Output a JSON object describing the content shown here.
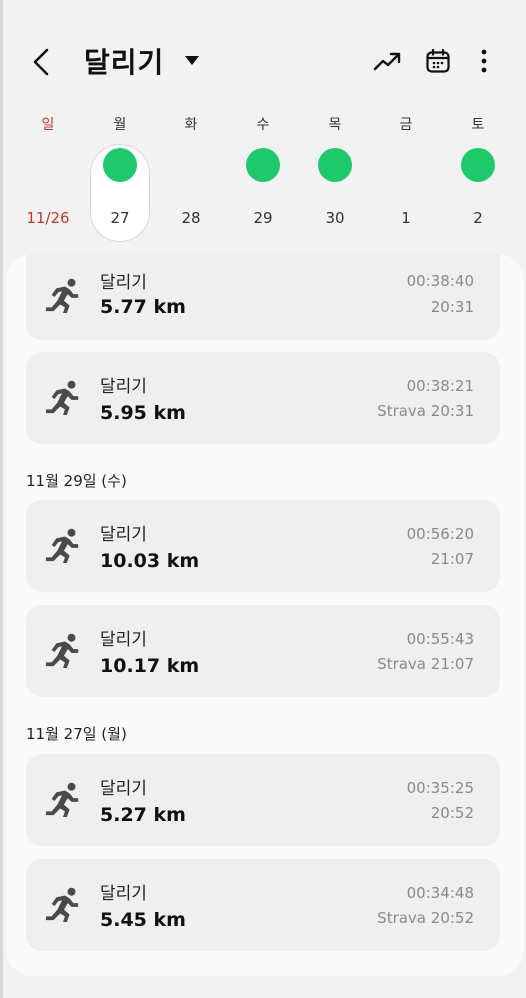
{
  "header": {
    "title": "달리기"
  },
  "week": {
    "days": [
      {
        "dow": "일",
        "date": "11/26",
        "has_record": false
      },
      {
        "dow": "월",
        "date": "27",
        "has_record": true
      },
      {
        "dow": "화",
        "date": "28",
        "has_record": false
      },
      {
        "dow": "수",
        "date": "29",
        "has_record": true
      },
      {
        "dow": "목",
        "date": "30",
        "has_record": true
      },
      {
        "dow": "금",
        "date": "1",
        "has_record": false
      },
      {
        "dow": "토",
        "date": "2",
        "has_record": true
      }
    ],
    "selected": "27",
    "dot_color": "#1ec96c"
  },
  "records": {
    "group_top": [
      {
        "name": "달리기",
        "distance": "5.77 km",
        "duration": "00:38:40",
        "time": "20:31"
      },
      {
        "name": "달리기",
        "distance": "5.95 km",
        "duration": "00:38:21",
        "time": "Strava 20:31"
      }
    ],
    "group_29": {
      "title": "11월 29일 (수)",
      "items": [
        {
          "name": "달리기",
          "distance": "10.03 km",
          "duration": "00:56:20",
          "time": "21:07"
        },
        {
          "name": "달리기",
          "distance": "10.17 km",
          "duration": "00:55:43",
          "time": "Strava 21:07"
        }
      ]
    },
    "group_27": {
      "title": "11월 27일 (월)",
      "items": [
        {
          "name": "달리기",
          "distance": "5.27 km",
          "duration": "00:35:25",
          "time": "20:52"
        },
        {
          "name": "달리기",
          "distance": "5.45 km",
          "duration": "00:34:48",
          "time": "Strava 20:52"
        }
      ]
    }
  },
  "icons": {
    "back": "chevron-left-icon",
    "dropdown": "caret-down-icon",
    "trend": "trend-up-icon",
    "calendar": "calendar-icon",
    "more": "more-vertical-icon",
    "run": "running-person-icon"
  }
}
